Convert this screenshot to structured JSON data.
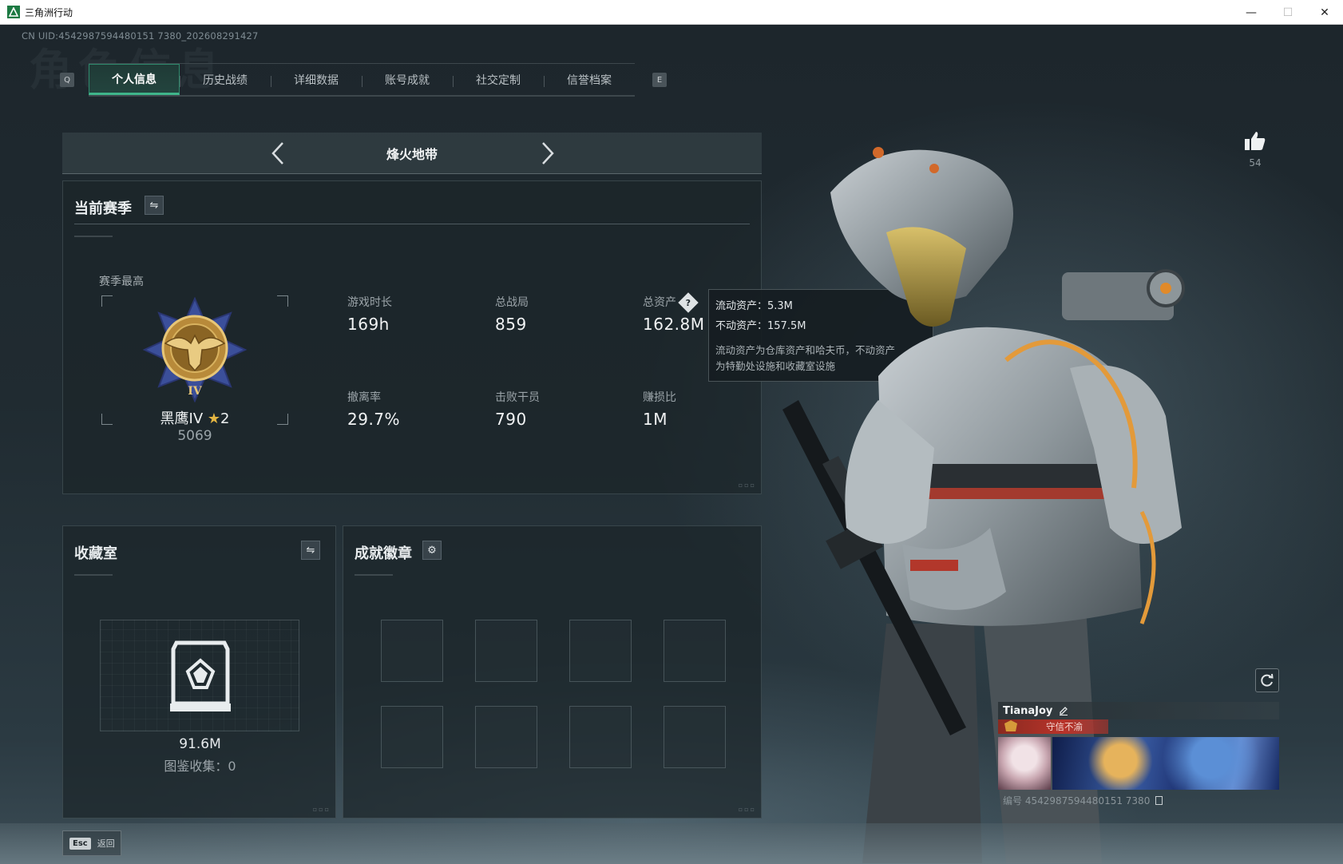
{
  "window": {
    "title": "三角洲行动",
    "controls": {
      "minimize": "—",
      "maximize": "☐",
      "close": "✕"
    }
  },
  "header": {
    "uid_text": "CN UID:4542987594480151 7380_202608291427",
    "background_watermark": "角色信息"
  },
  "tabs": {
    "left_key": "Q",
    "right_key": "E",
    "items": [
      {
        "label": "个人信息",
        "active": true
      },
      {
        "label": "历史战绩",
        "active": false
      },
      {
        "label": "详细数据",
        "active": false
      },
      {
        "label": "账号成就",
        "active": false
      },
      {
        "label": "社交定制",
        "active": false
      },
      {
        "label": "信誉档案",
        "active": false
      }
    ]
  },
  "mode": {
    "title": "烽火地带"
  },
  "season": {
    "title": "当前赛季",
    "rank_label": "赛季最高",
    "rank_name": "黑鹰IV",
    "rank_star_icon": "star-icon",
    "rank_stars": "2",
    "rank_score": "5069",
    "stats": [
      {
        "label": "游戏时长",
        "value": "169h"
      },
      {
        "label": "总战局",
        "value": "859"
      },
      {
        "label": "总资产",
        "value": "162.8M",
        "help": "?"
      },
      {
        "label": "撤离率",
        "value": "29.7%"
      },
      {
        "label": "击败干员",
        "value": "790"
      },
      {
        "label": "赚损比",
        "value": "1M"
      }
    ]
  },
  "tooltip": {
    "liquid": "流动资产：5.3M",
    "fixed": "不动资产：157.5M",
    "note_line1": "流动资产为仓库资产和哈夫币，不动资产",
    "note_line2": "为特勤处设施和收藏室设施"
  },
  "collection": {
    "title": "收藏室",
    "value": "91.6M",
    "count_text": "图鉴收集：0"
  },
  "badges": {
    "title": "成就徽章",
    "slots": 8
  },
  "likes": {
    "count": "54"
  },
  "player": {
    "name": "TianaJoy",
    "title": "守信不渝",
    "id_text": "编号 4542987594480151 7380"
  },
  "footer": {
    "esc_key": "Esc",
    "esc_label": "返回"
  },
  "colors": {
    "accent": "#3fb58a",
    "title_bar_red": "#b8332a",
    "rank_gold": "#e5b642"
  }
}
